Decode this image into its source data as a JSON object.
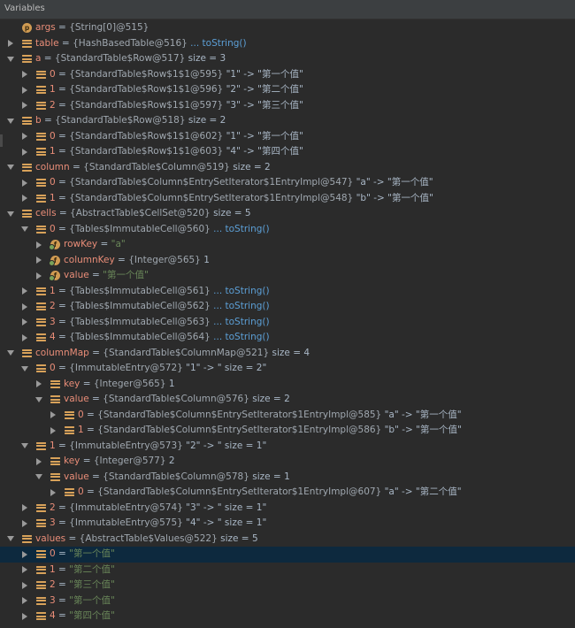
{
  "header": {
    "title": "Variables"
  },
  "tree": [
    {
      "d": 0,
      "exp": "none",
      "icon": "param",
      "name": "args",
      "val": "{String[0]@515}",
      "tail": "",
      "tailKind": ""
    },
    {
      "d": 0,
      "exp": "collapsed",
      "icon": "field",
      "name": "table",
      "val": "{HashBasedTable@516}",
      "tail": "... toString()",
      "tailKind": "link"
    },
    {
      "d": 0,
      "exp": "expanded",
      "icon": "field",
      "name": "a",
      "val": "{StandardTable$Row@517}",
      "tail": "size = 3",
      "tailKind": "plain"
    },
    {
      "d": 1,
      "exp": "collapsed",
      "icon": "field",
      "name": "0",
      "val": "{StandardTable$Row$1$1@595}",
      "tail": "\"1\" -> \"第一个值\"",
      "tailKind": "plain"
    },
    {
      "d": 1,
      "exp": "collapsed",
      "icon": "field",
      "name": "1",
      "val": "{StandardTable$Row$1$1@596}",
      "tail": "\"2\" -> \"第二个值\"",
      "tailKind": "plain"
    },
    {
      "d": 1,
      "exp": "collapsed",
      "icon": "field",
      "name": "2",
      "val": "{StandardTable$Row$1$1@597}",
      "tail": "\"3\" -> \"第三个值\"",
      "tailKind": "plain"
    },
    {
      "d": 0,
      "exp": "expanded",
      "icon": "field",
      "name": "b",
      "val": "{StandardTable$Row@518}",
      "tail": "size = 2",
      "tailKind": "plain"
    },
    {
      "d": 1,
      "exp": "collapsed",
      "icon": "field",
      "name": "0",
      "val": "{StandardTable$Row$1$1@602}",
      "tail": "\"1\" -> \"第一个值\"",
      "tailKind": "plain"
    },
    {
      "d": 1,
      "exp": "collapsed",
      "icon": "field",
      "name": "1",
      "val": "{StandardTable$Row$1$1@603}",
      "tail": "\"4\" -> \"第四个值\"",
      "tailKind": "plain"
    },
    {
      "d": 0,
      "exp": "expanded",
      "icon": "field",
      "name": "column",
      "val": "{StandardTable$Column@519}",
      "tail": "size = 2",
      "tailKind": "plain"
    },
    {
      "d": 1,
      "exp": "collapsed",
      "icon": "field",
      "name": "0",
      "val": "{StandardTable$Column$EntrySetIterator$1EntryImpl@547}",
      "tail": "\"a\" -> \"第一个值\"",
      "tailKind": "plain"
    },
    {
      "d": 1,
      "exp": "collapsed",
      "icon": "field",
      "name": "1",
      "val": "{StandardTable$Column$EntrySetIterator$1EntryImpl@548}",
      "tail": "\"b\" -> \"第一个值\"",
      "tailKind": "plain"
    },
    {
      "d": 0,
      "exp": "expanded",
      "icon": "field",
      "name": "cells",
      "val": "{AbstractTable$CellSet@520}",
      "tail": "size = 5",
      "tailKind": "plain"
    },
    {
      "d": 1,
      "exp": "expanded",
      "icon": "field",
      "name": "0",
      "val": "{Tables$ImmutableCell@560}",
      "tail": "... toString()",
      "tailKind": "link"
    },
    {
      "d": 2,
      "exp": "collapsed",
      "icon": "final",
      "name": "rowKey",
      "val": "",
      "tail": "\"a\"",
      "tailKind": "str"
    },
    {
      "d": 2,
      "exp": "collapsed",
      "icon": "final",
      "name": "columnKey",
      "val": "{Integer@565}",
      "tail": "1",
      "tailKind": "plain"
    },
    {
      "d": 2,
      "exp": "collapsed",
      "icon": "final",
      "name": "value",
      "val": "",
      "tail": "\"第一个值\"",
      "tailKind": "str"
    },
    {
      "d": 1,
      "exp": "collapsed",
      "icon": "field",
      "name": "1",
      "val": "{Tables$ImmutableCell@561}",
      "tail": "... toString()",
      "tailKind": "link"
    },
    {
      "d": 1,
      "exp": "collapsed",
      "icon": "field",
      "name": "2",
      "val": "{Tables$ImmutableCell@562}",
      "tail": "... toString()",
      "tailKind": "link"
    },
    {
      "d": 1,
      "exp": "collapsed",
      "icon": "field",
      "name": "3",
      "val": "{Tables$ImmutableCell@563}",
      "tail": "... toString()",
      "tailKind": "link"
    },
    {
      "d": 1,
      "exp": "collapsed",
      "icon": "field",
      "name": "4",
      "val": "{Tables$ImmutableCell@564}",
      "tail": "... toString()",
      "tailKind": "link"
    },
    {
      "d": 0,
      "exp": "expanded",
      "icon": "field",
      "name": "columnMap",
      "val": "{StandardTable$ColumnMap@521}",
      "tail": "size = 4",
      "tailKind": "plain"
    },
    {
      "d": 1,
      "exp": "expanded",
      "icon": "field",
      "name": "0",
      "val": "{ImmutableEntry@572}",
      "tail": "\"1\" -> \" size = 2\"",
      "tailKind": "plain"
    },
    {
      "d": 2,
      "exp": "collapsed",
      "icon": "field",
      "name": "key",
      "val": "{Integer@565}",
      "tail": "1",
      "tailKind": "plain"
    },
    {
      "d": 2,
      "exp": "expanded",
      "icon": "field",
      "name": "value",
      "val": "{StandardTable$Column@576}",
      "tail": "size = 2",
      "tailKind": "plain"
    },
    {
      "d": 3,
      "exp": "collapsed",
      "icon": "field",
      "name": "0",
      "val": "{StandardTable$Column$EntrySetIterator$1EntryImpl@585}",
      "tail": "\"a\" -> \"第一个值\"",
      "tailKind": "plain"
    },
    {
      "d": 3,
      "exp": "collapsed",
      "icon": "field",
      "name": "1",
      "val": "{StandardTable$Column$EntrySetIterator$1EntryImpl@586}",
      "tail": "\"b\" -> \"第一个值\"",
      "tailKind": "plain"
    },
    {
      "d": 1,
      "exp": "expanded",
      "icon": "field",
      "name": "1",
      "val": "{ImmutableEntry@573}",
      "tail": "\"2\" -> \" size = 1\"",
      "tailKind": "plain"
    },
    {
      "d": 2,
      "exp": "collapsed",
      "icon": "field",
      "name": "key",
      "val": "{Integer@577}",
      "tail": "2",
      "tailKind": "plain"
    },
    {
      "d": 2,
      "exp": "expanded",
      "icon": "field",
      "name": "value",
      "val": "{StandardTable$Column@578}",
      "tail": "size = 1",
      "tailKind": "plain"
    },
    {
      "d": 3,
      "exp": "collapsed",
      "icon": "field",
      "name": "0",
      "val": "{StandardTable$Column$EntrySetIterator$1EntryImpl@607}",
      "tail": "\"a\" -> \"第二个值\"",
      "tailKind": "plain"
    },
    {
      "d": 1,
      "exp": "collapsed",
      "icon": "field",
      "name": "2",
      "val": "{ImmutableEntry@574}",
      "tail": "\"3\" -> \" size = 1\"",
      "tailKind": "plain"
    },
    {
      "d": 1,
      "exp": "collapsed",
      "icon": "field",
      "name": "3",
      "val": "{ImmutableEntry@575}",
      "tail": "\"4\" -> \" size = 1\"",
      "tailKind": "plain"
    },
    {
      "d": 0,
      "exp": "expanded",
      "icon": "field",
      "name": "values",
      "val": "{AbstractTable$Values@522}",
      "tail": "size = 5",
      "tailKind": "plain"
    },
    {
      "d": 1,
      "exp": "collapsed",
      "icon": "field",
      "name": "0",
      "val": "",
      "tail": "\"第一个值\"",
      "tailKind": "str",
      "selected": true
    },
    {
      "d": 1,
      "exp": "collapsed",
      "icon": "field",
      "name": "1",
      "val": "",
      "tail": "\"第二个值\"",
      "tailKind": "str"
    },
    {
      "d": 1,
      "exp": "collapsed",
      "icon": "field",
      "name": "2",
      "val": "",
      "tail": "\"第三个值\"",
      "tailKind": "str"
    },
    {
      "d": 1,
      "exp": "collapsed",
      "icon": "field",
      "name": "3",
      "val": "",
      "tail": "\"第一个值\"",
      "tailKind": "str"
    },
    {
      "d": 1,
      "exp": "collapsed",
      "icon": "field",
      "name": "4",
      "val": "",
      "tail": "\"第四个值\"",
      "tailKind": "str"
    }
  ]
}
